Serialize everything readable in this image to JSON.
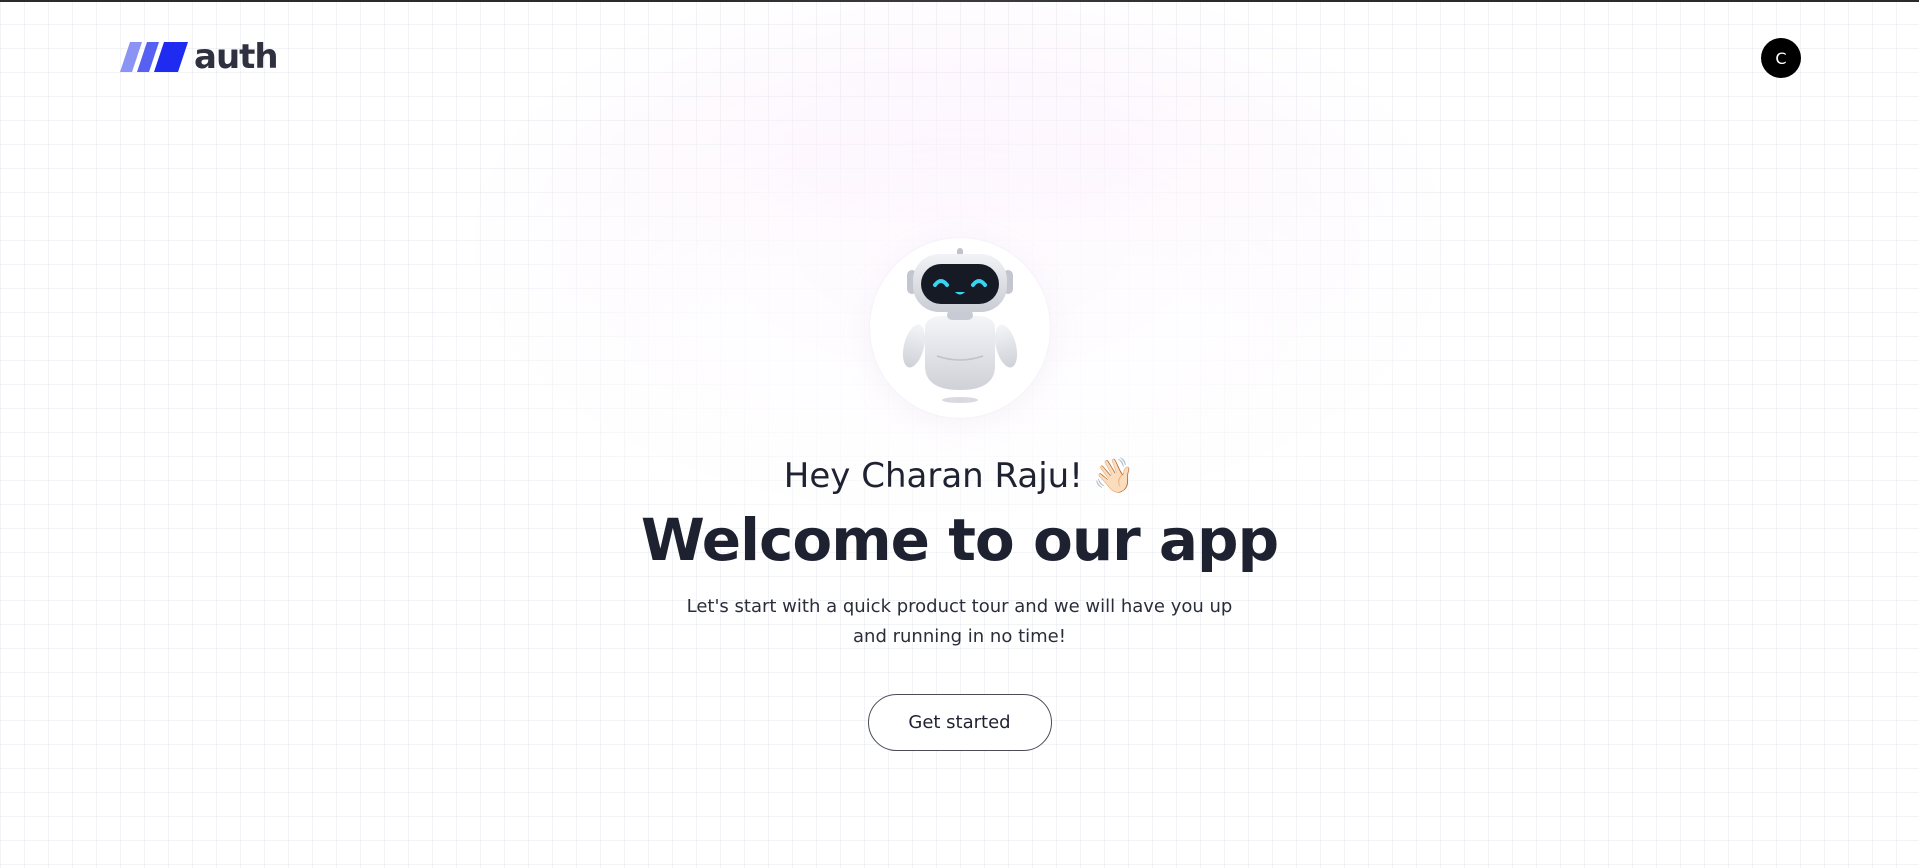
{
  "header": {
    "logo_text": "auth",
    "avatar_initial": "C"
  },
  "hero": {
    "greeting": "Hey Charan Raju!",
    "greeting_emoji": "👋🏻",
    "title": "Welcome to our app",
    "subtitle": "Let's start with a quick product tour and we will have you up and running in no time!",
    "cta_label": "Get started"
  },
  "colors": {
    "brand_primary": "#1f2bf0",
    "brand_light": "#8b93f5",
    "text_dark": "#1f2230",
    "avatar_bg": "#000000",
    "robot_eyes": "#3ad4f2"
  },
  "icons": {
    "logo": "slanted-bars-logo-icon",
    "robot": "robot-illustration",
    "wave": "waving-hand-icon"
  }
}
